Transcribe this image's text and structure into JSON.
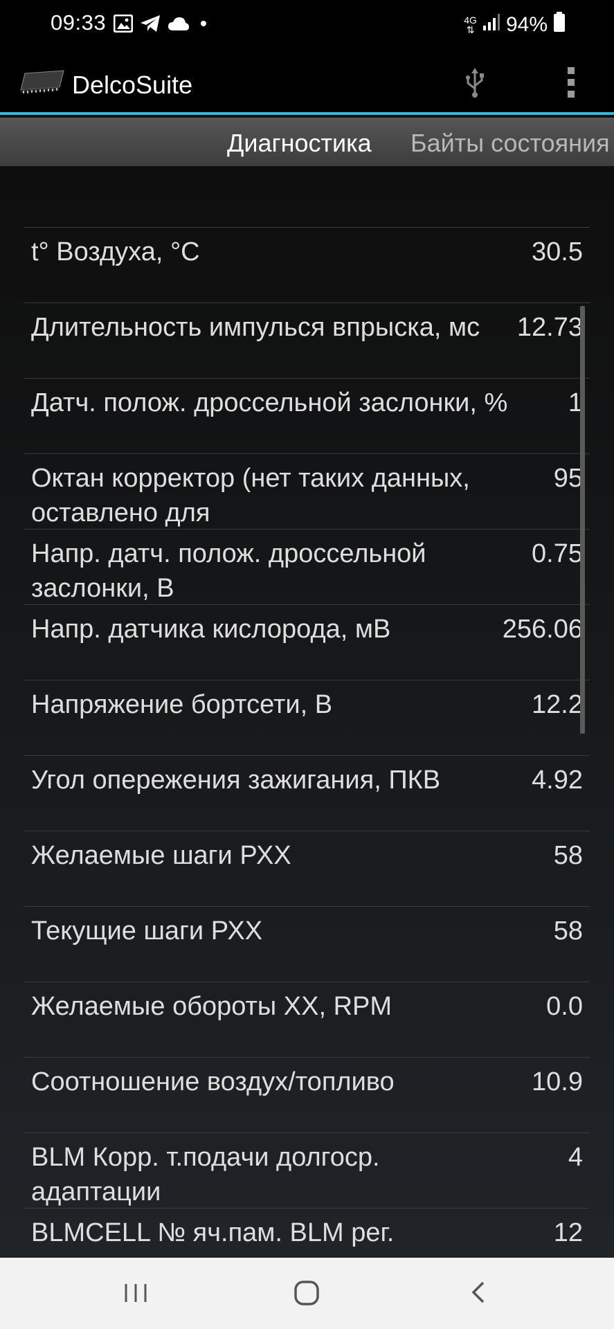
{
  "status_bar": {
    "time": "09:33",
    "network_type_top": "4G",
    "battery": "94%",
    "icons": [
      "gallery-icon",
      "telegram-icon",
      "cloud-icon",
      "dot-icon",
      "signal-icon",
      "battery-icon"
    ]
  },
  "action_bar": {
    "title": "DelcoSuite",
    "accent_color": "#33b5e5"
  },
  "tabs": [
    {
      "label": "Диагностика",
      "active": true
    },
    {
      "label": "Байты состояния",
      "active": false
    }
  ],
  "parameters": [
    {
      "name": "t° Воздуха, °C",
      "value": "30.5"
    },
    {
      "name": "Длительность импулься впрыска, мс",
      "value": "12.73"
    },
    {
      "name": "Датч. полож. дроссельной заслонки, %",
      "value": "1"
    },
    {
      "name": "Октан корректор (нет таких данных, оставлено для",
      "value": "95"
    },
    {
      "name": "Напр. датч. полож. дроссельной заслонки, В",
      "value": "0.75"
    },
    {
      "name": "Напр. датчика кислорода, мВ",
      "value": "256.06"
    },
    {
      "name": "Напряжение бортсети, В",
      "value": "12.2"
    },
    {
      "name": "Угол опережения зажигания, ПКВ",
      "value": "4.92"
    },
    {
      "name": "Желаемые шаги РХХ",
      "value": "58"
    },
    {
      "name": "Текущие шаги РХХ",
      "value": "58"
    },
    {
      "name": "Желаемые обороты ХХ, RPM",
      "value": "0.0"
    },
    {
      "name": "Соотношение воздух/топливо",
      "value": "10.9"
    },
    {
      "name": "BLM Корр. т.подачи долгоср. адаптации",
      "value": "4"
    },
    {
      "name": "BLMCELL № яч.пам. BLM рег.",
      "value": "12"
    }
  ]
}
